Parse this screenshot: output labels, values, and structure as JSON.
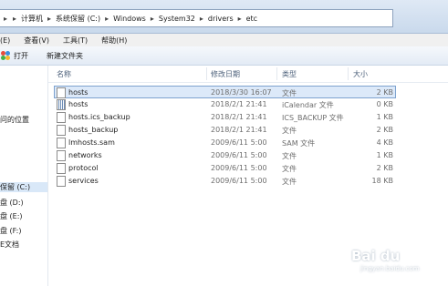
{
  "address": {
    "crumbs": [
      "计算机",
      "系统保留 (C:)",
      "Windows",
      "System32",
      "drivers",
      "etc"
    ]
  },
  "menu": [
    "(E)",
    "查看(V)",
    "工具(T)",
    "帮助(H)"
  ],
  "toolbar": {
    "open_label": "打开",
    "new_folder_label": "新建文件夹"
  },
  "sidebar": {
    "items": [
      {
        "label": "问的位置"
      },
      {
        "label": "保留 (C:)",
        "selected": true
      },
      {
        "label": "盘 (D:)"
      },
      {
        "label": "盘 (E:)"
      },
      {
        "label": "盘 (F:)"
      },
      {
        "label": "E文档"
      }
    ]
  },
  "columns": {
    "name": "名称",
    "date": "修改日期",
    "type": "类型",
    "size": "大小"
  },
  "files": [
    {
      "name": "hosts",
      "date": "2018/3/30 16:07",
      "type": "文件",
      "size": "2 KB",
      "selected": true,
      "icon": "file-icon"
    },
    {
      "name": "hosts",
      "date": "2018/2/1 21:41",
      "type": "iCalendar 文件",
      "size": "0 KB",
      "icon": "calendar-file-icon"
    },
    {
      "name": "hosts.ics_backup",
      "date": "2018/2/1 21:41",
      "type": "ICS_BACKUP 文件",
      "size": "1 KB",
      "icon": "file-icon"
    },
    {
      "name": "hosts_backup",
      "date": "2018/2/1 21:41",
      "type": "文件",
      "size": "2 KB",
      "icon": "file-icon"
    },
    {
      "name": "lmhosts.sam",
      "date": "2009/6/11 5:00",
      "type": "SAM 文件",
      "size": "4 KB",
      "icon": "file-icon"
    },
    {
      "name": "networks",
      "date": "2009/6/11 5:00",
      "type": "文件",
      "size": "1 KB",
      "icon": "file-icon"
    },
    {
      "name": "protocol",
      "date": "2009/6/11 5:00",
      "type": "文件",
      "size": "2 KB",
      "icon": "file-icon"
    },
    {
      "name": "services",
      "date": "2009/6/11 5:00",
      "type": "文件",
      "size": "18 KB",
      "icon": "file-icon"
    }
  ],
  "watermark": {
    "text": "Bai du",
    "sub": "jingyan.baidu.com"
  }
}
